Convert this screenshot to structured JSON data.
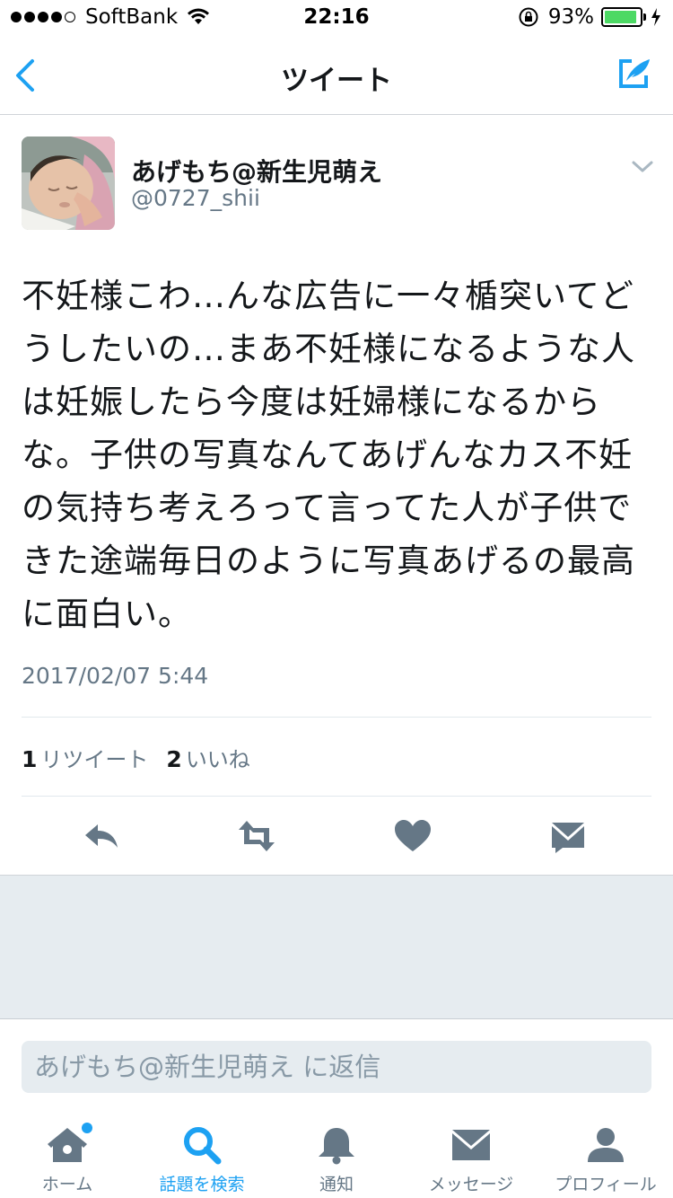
{
  "status_bar": {
    "carrier": "SoftBank",
    "time": "22:16",
    "battery_percent": "93%",
    "battery_level": 0.93
  },
  "nav": {
    "title": "ツイート",
    "back_icon": "chevron-left-icon",
    "compose_icon": "compose-quill-icon"
  },
  "tweet": {
    "display_name": "あげもち@新生児萌え",
    "handle": "@0727_shii",
    "text": "不妊様こわ…んな広告に一々楯突いてどうしたいの…まあ不妊様になるような人は妊娠したら今度は妊婦様になるからな。子供の写真なんてあげんなカス不妊の気持ち考えろって言ってた人が子供できた途端毎日のように写真あげるの最高に面白い。",
    "timestamp": "2017/02/07 5:44",
    "retweet_count": "1",
    "retweet_label": "リツイート",
    "like_count": "2",
    "like_label": "いいね"
  },
  "actions": [
    "reply-icon",
    "retweet-icon",
    "like-heart-icon",
    "direct-message-icon"
  ],
  "reply": {
    "placeholder": "あげもち@新生児萌え に返信"
  },
  "tabbar": {
    "items": [
      {
        "label": "ホーム",
        "icon": "home-icon"
      },
      {
        "label": "話題を検索",
        "icon": "search-icon"
      },
      {
        "label": "通知",
        "icon": "bell-icon"
      },
      {
        "label": "メッセージ",
        "icon": "envelope-icon"
      },
      {
        "label": "プロフィール",
        "icon": "person-icon"
      }
    ],
    "active_index": 1
  },
  "colors": {
    "accent": "#1da1f2",
    "text_primary": "#14171a",
    "text_secondary": "#657786",
    "icon_grey": "#657786",
    "background_grey": "#e6ecf0",
    "battery_green": "#4cd964"
  }
}
